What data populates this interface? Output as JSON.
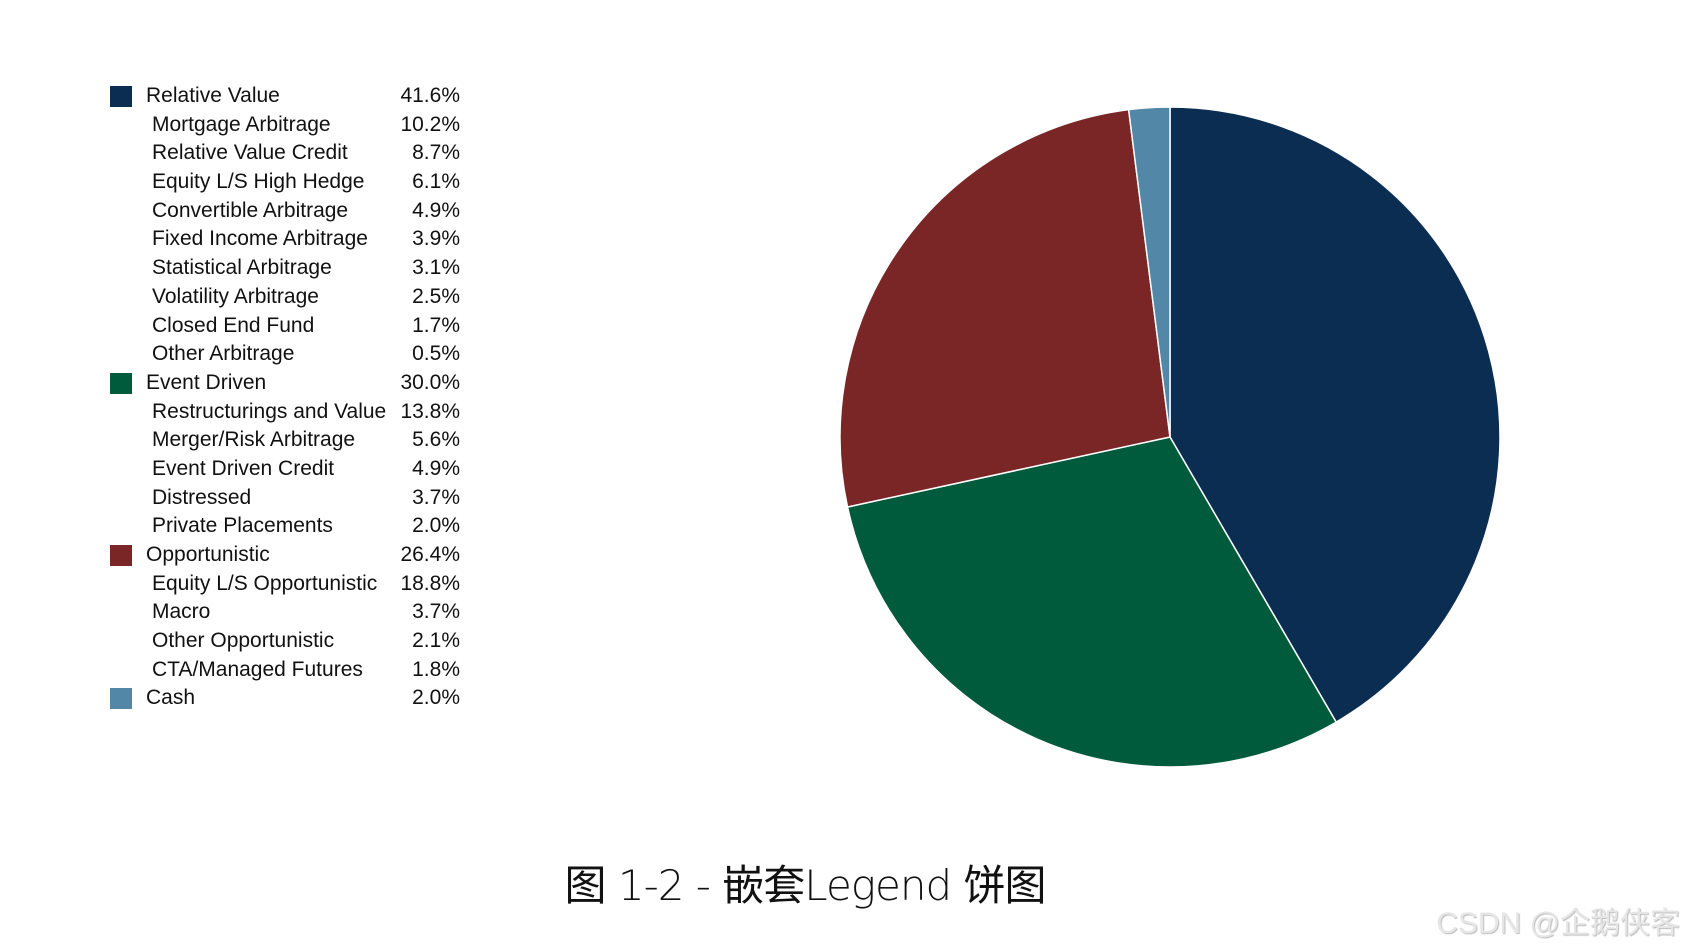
{
  "chart_data": {
    "type": "pie",
    "title": "",
    "caption": "图 1-2 - 嵌套Legend 饼图",
    "legend_position": "left",
    "start_angle_deg": 0,
    "direction": "clockwise",
    "slices": [
      {
        "name": "Relative Value",
        "value": 41.6,
        "label": "41.6%",
        "color": "#0b2d52"
      },
      {
        "name": "Event Driven",
        "value": 30.0,
        "label": "30.0%",
        "color": "#005a3c"
      },
      {
        "name": "Opportunistic",
        "value": 26.4,
        "label": "26.4%",
        "color": "#7a2627"
      },
      {
        "name": "Cash",
        "value": 2.0,
        "label": "2.0%",
        "color": "#5287a8"
      }
    ],
    "legend": [
      {
        "label": "Relative Value",
        "value": "41.6%",
        "group": true,
        "color": "#0b2d52"
      },
      {
        "label": "Mortgage Arbitrage",
        "value": "10.2%"
      },
      {
        "label": "Relative Value Credit",
        "value": "8.7%"
      },
      {
        "label": "Equity L/S High Hedge",
        "value": "6.1%"
      },
      {
        "label": "Convertible Arbitrage",
        "value": "4.9%"
      },
      {
        "label": "Fixed Income Arbitrage",
        "value": "3.9%"
      },
      {
        "label": "Statistical Arbitrage",
        "value": "3.1%"
      },
      {
        "label": "Volatility Arbitrage",
        "value": "2.5%"
      },
      {
        "label": "Closed End Fund",
        "value": "1.7%"
      },
      {
        "label": "Other Arbitrage",
        "value": "0.5%"
      },
      {
        "label": "Event Driven",
        "value": "30.0%",
        "group": true,
        "color": "#005a3c"
      },
      {
        "label": "Restructurings and Value",
        "value": "13.8%"
      },
      {
        "label": "Merger/Risk Arbitrage",
        "value": "5.6%"
      },
      {
        "label": "Event Driven Credit",
        "value": "4.9%"
      },
      {
        "label": "Distressed",
        "value": "3.7%"
      },
      {
        "label": "Private Placements",
        "value": "2.0%"
      },
      {
        "label": "Opportunistic",
        "value": "26.4%",
        "group": true,
        "color": "#7a2627"
      },
      {
        "label": "Equity L/S Opportunistic",
        "value": "18.8%"
      },
      {
        "label": "Macro",
        "value": "3.7%"
      },
      {
        "label": "Other Opportunistic",
        "value": "2.1%"
      },
      {
        "label": "CTA/Managed Futures",
        "value": "1.8%"
      },
      {
        "label": "Cash",
        "value": "2.0%",
        "group": true,
        "color": "#5287a8"
      }
    ]
  },
  "watermark": "CSDN @企鹅侠客"
}
